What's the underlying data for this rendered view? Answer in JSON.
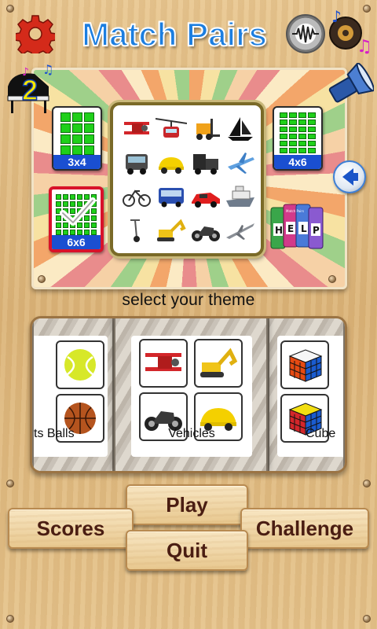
{
  "header": {
    "title": "Match Pairs",
    "settings_icon": "gear-icon",
    "sound_icon": "speaker-waveform-icon",
    "music_icon": "music-notes-icon",
    "level_badge_value": "2",
    "colors": {
      "title": "#1c7ee0",
      "gear": "#d42a1a"
    }
  },
  "board": {
    "grid_options": [
      {
        "label": "3x4",
        "selected": false
      },
      {
        "label": "4x6",
        "selected": false
      },
      {
        "label": "6x6",
        "selected": true
      }
    ],
    "preview_theme": "Vehicles",
    "preview_items": [
      "biplane",
      "cable-car",
      "forklift",
      "sailboat",
      "truck",
      "beetle-car",
      "semi-truck",
      "airliner",
      "bicycle",
      "bus",
      "sports-car",
      "cruise-ship",
      "segway",
      "excavator",
      "motorcycle",
      "fighter-jet"
    ],
    "help_cards": [
      "H",
      "E",
      "L",
      "P"
    ],
    "help_card_caption": "Match Pairs",
    "next_arrow_icon": "arrow-left-icon",
    "flashlight_icon": "flashlight-icon"
  },
  "caption": "select your theme",
  "themes": {
    "left_label": "ts Balls",
    "mid_label": "Vehicles",
    "right_label": "Cube"
  },
  "buttons": {
    "play": "Play",
    "scores": "Scores",
    "challenge": "Challenge",
    "quit": "Quit"
  },
  "colors": {
    "selected_border": "#d8122a",
    "grid_green": "#1fd01a",
    "label_blue": "#1a4fd1",
    "button_text": "#4a1d12"
  }
}
